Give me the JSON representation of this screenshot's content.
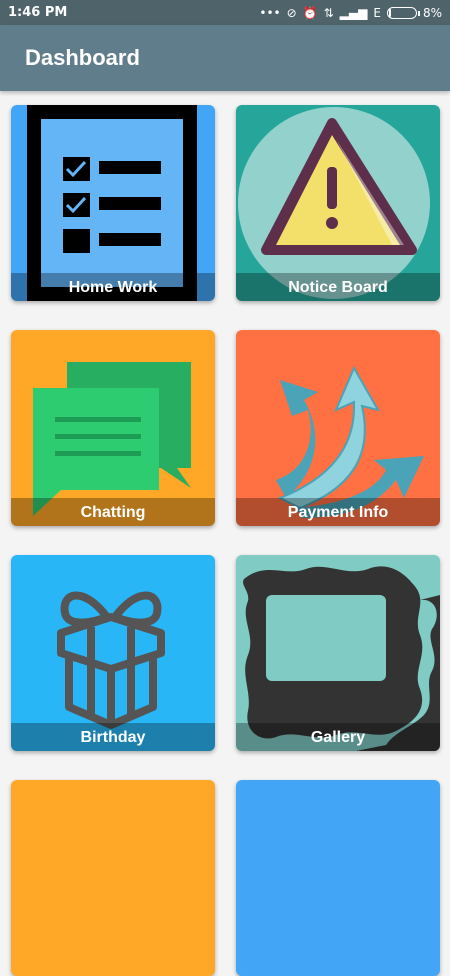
{
  "status_bar": {
    "time": "1:46 PM",
    "network": "E",
    "battery_percent": "8%",
    "battery_level": 0.08
  },
  "app_bar": {
    "title": "Dashboard"
  },
  "tiles": [
    {
      "label": "Home Work",
      "color": "#42a5f5",
      "icon": "checklist-icon"
    },
    {
      "label": "Notice Board",
      "color": "#26a69a",
      "icon": "warning-icon"
    },
    {
      "label": "Chatting",
      "color": "#ffa726",
      "icon": "chat-icon"
    },
    {
      "label": "Payment Info",
      "color": "#ff7043",
      "icon": "arrows-icon"
    },
    {
      "label": "Birthday",
      "color": "#29b6f6",
      "icon": "gift-icon"
    },
    {
      "label": "Gallery",
      "color": "#80cbc4",
      "icon": "frame-icon"
    }
  ]
}
